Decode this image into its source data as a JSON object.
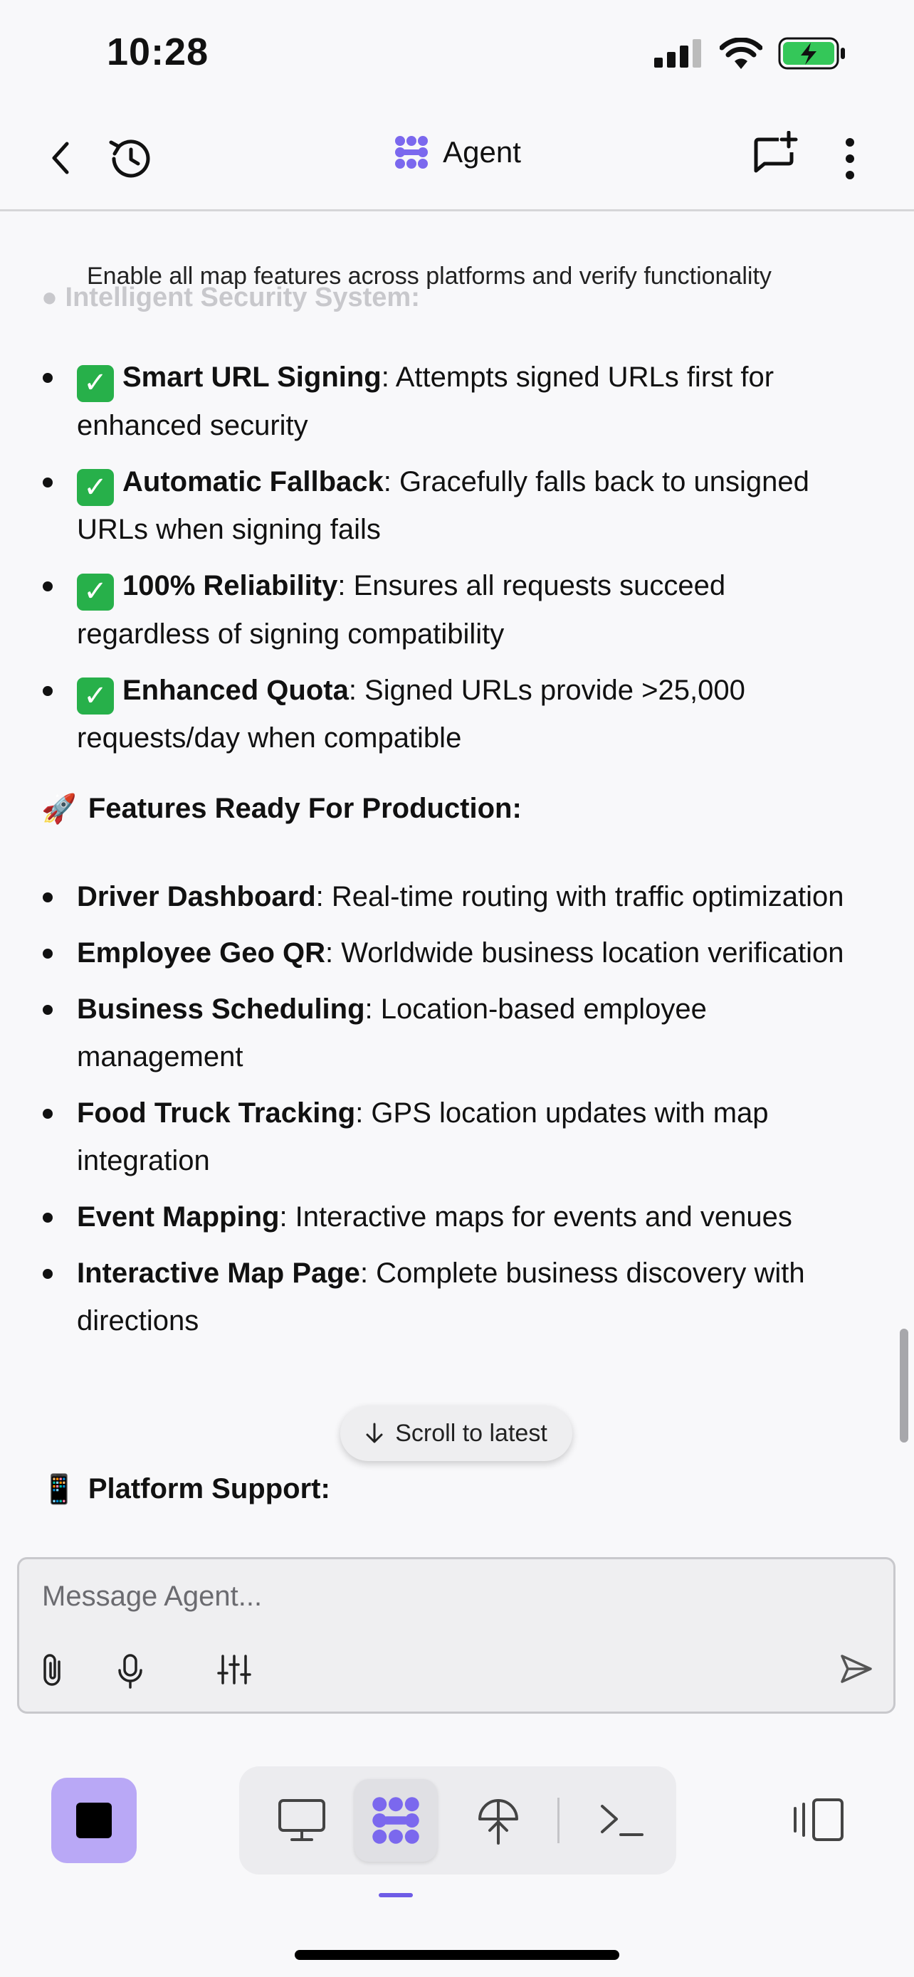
{
  "status_bar": {
    "time": "10:28"
  },
  "nav": {
    "title": "Agent"
  },
  "task_banner": "Enable all map features across platforms and verify functionality",
  "ghost_heading": "Intelligent Security System:",
  "security_items": [
    {
      "bold": "Smart URL Signing",
      "text": ": Attempts signed URLs first for enhanced security"
    },
    {
      "bold": "Automatic Fallback",
      "text": ": Gracefully falls back to unsigned URLs when signing fails"
    },
    {
      "bold": "100% Reliability",
      "text": ": Ensures all requests succeed regardless of signing compatibility"
    },
    {
      "bold": "Enhanced Quota",
      "text": ": Signed URLs provide >25,000 requests/day when compatible"
    }
  ],
  "features_heading": {
    "emoji": "🚀",
    "text": "Features Ready For Production:"
  },
  "features": [
    {
      "bold": "Driver Dashboard",
      "text": ": Real-time routing with traffic optimization"
    },
    {
      "bold": "Employee Geo QR",
      "text": ": Worldwide business location verification"
    },
    {
      "bold": "Business Scheduling",
      "text": ": Location-based employee management"
    },
    {
      "bold": "Food Truck Tracking",
      "text": ": GPS location updates with map integration"
    },
    {
      "bold": "Event Mapping",
      "text": ": Interactive maps for events and venues"
    },
    {
      "bold": "Interactive Map Page",
      "text": ": Complete business discovery with directions"
    }
  ],
  "platform_heading": {
    "emoji": "📱",
    "text": "Platform Support:"
  },
  "scroll_to_latest": "Scroll to latest",
  "composer": {
    "placeholder": "Message Agent..."
  },
  "icons": {
    "back": "chevron-left-icon",
    "history": "history-icon",
    "agent_logo": "agent-logo-icon",
    "new_chat": "new-chat-icon",
    "more": "more-vertical-icon",
    "attach": "paperclip-icon",
    "mic": "microphone-icon",
    "settings": "sliders-icon",
    "send": "send-icon",
    "desktop": "monitor-icon",
    "agent": "agent-icon",
    "deploy": "deploy-icon",
    "terminal": "terminal-icon",
    "layout": "layout-toggle-icon"
  },
  "colors": {
    "accent": "#7b68ee",
    "stop_button": "#b9a8f6",
    "check": "#27b04a"
  }
}
